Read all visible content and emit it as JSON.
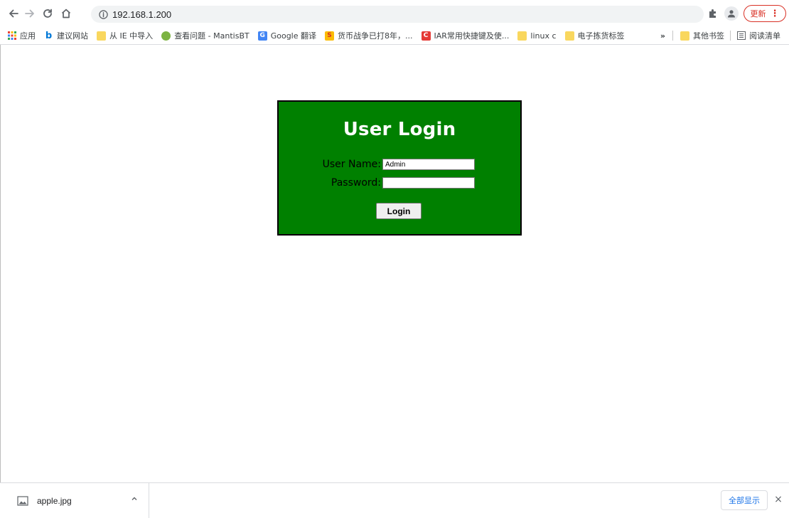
{
  "browser": {
    "url": "192.168.1.200",
    "update_label": "更新",
    "accent_color": "#d93025"
  },
  "toolbar_icons": {
    "back": "back-arrow-icon",
    "forward": "forward-arrow-icon",
    "reload": "reload-icon",
    "home": "home-icon",
    "site_info": "globe-info-icon",
    "extensions": "puzzle-icon",
    "profile": "person-icon",
    "menu": "three-dots-icon"
  },
  "bookmarks": {
    "items": [
      {
        "label": "应用",
        "icon": "apps-grid-icon"
      },
      {
        "label": "建议网站",
        "icon": "bing-icon"
      },
      {
        "label": "从 IE 中导入",
        "icon": "folder-icon"
      },
      {
        "label": "查看问题 - MantisBT",
        "icon": "mantis-icon"
      },
      {
        "label": "Google 翻译",
        "icon": "google-translate-icon"
      },
      {
        "label": "货币战争已打8年，...",
        "icon": "s-logo-icon"
      },
      {
        "label": "IAR常用快捷键及使...",
        "icon": "c-logo-icon"
      },
      {
        "label": "linux c",
        "icon": "folder-icon"
      },
      {
        "label": "电子拣货标签",
        "icon": "folder-icon"
      }
    ],
    "overflow": "»",
    "other_bookmarks": "其他书签",
    "reading_list": "阅读清单"
  },
  "login": {
    "title": "User Login",
    "username_label": "User Name:",
    "username_value": "Admin",
    "password_label": "Password:",
    "password_value": "",
    "button_label": "Login",
    "box_color": "#008000"
  },
  "downloads": {
    "file_name": "apple.jpg",
    "show_all_label": "全部显示",
    "close": "×"
  }
}
